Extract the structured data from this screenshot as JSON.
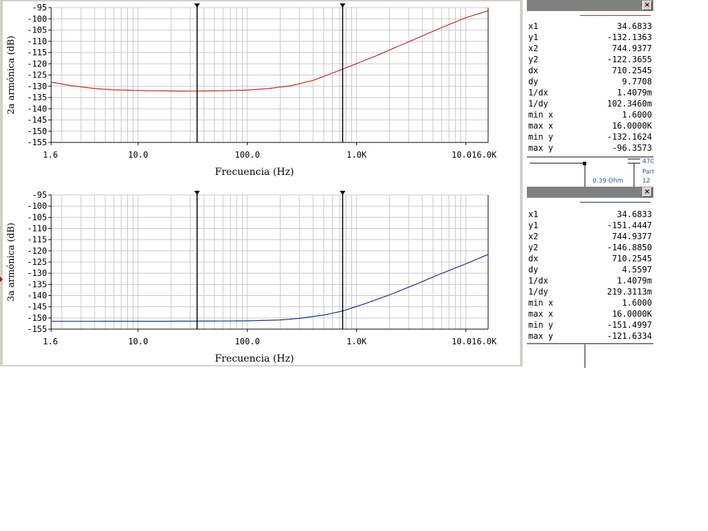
{
  "colors": {
    "trace1": "#cc2020",
    "trace2": "#1a2a90",
    "grid": "#c8c8c8",
    "cursor": "#000000",
    "window_bg": "#d4d0c8"
  },
  "chart_data": [
    {
      "type": "line",
      "x_scale": "log",
      "xlabel": "Frecuencia (Hz)",
      "ylabel": "2a armónica (dB)",
      "xlim": [
        1.6,
        16000
      ],
      "ylim": [
        -155,
        -95
      ],
      "yticks": [
        -95,
        -100,
        -105,
        -110,
        -115,
        -120,
        -125,
        -130,
        -135,
        -140,
        -145,
        -150,
        -155
      ],
      "xtick_labels": [
        "1.6",
        "10.0",
        "100.0",
        "1.0K",
        "10.016.0K"
      ],
      "grid": true,
      "cursors_x": [
        34.6833,
        744.9377
      ],
      "series": [
        {
          "x": [
            1.6,
            2.5,
            4,
            6,
            10,
            20,
            34.68,
            60,
            100,
            150,
            250,
            400,
            744.94,
            1500,
            3000,
            6000,
            10000,
            16000
          ],
          "y": [
            -128.2,
            -129.8,
            -131.0,
            -131.6,
            -131.9,
            -132.1,
            -132.14,
            -132.0,
            -131.7,
            -131.1,
            -129.8,
            -127.4,
            -122.4,
            -116.5,
            -110.2,
            -103.9,
            -99.5,
            -96.4
          ]
        }
      ]
    },
    {
      "type": "line",
      "x_scale": "log",
      "xlabel": "Frecuencia (Hz)",
      "ylabel": "3a armónica (dB)",
      "xlim": [
        1.6,
        16000
      ],
      "ylim": [
        -155,
        -95
      ],
      "yticks": [
        -95,
        -100,
        -105,
        -110,
        -115,
        -120,
        -125,
        -130,
        -135,
        -140,
        -145,
        -150,
        -155
      ],
      "xtick_labels": [
        "1.6",
        "10.0",
        "100.0",
        "1.0K",
        "10.016.0K"
      ],
      "grid": true,
      "cursors_x": [
        34.6833,
        744.9377
      ],
      "series": [
        {
          "x": [
            1.6,
            10,
            34.68,
            100,
            200,
            300,
            500,
            744.94,
            1200,
            2000,
            3500,
            6000,
            10000,
            16000
          ],
          "y": [
            -151.5,
            -151.48,
            -151.44,
            -151.3,
            -150.9,
            -150.2,
            -148.7,
            -146.9,
            -143.6,
            -139.7,
            -134.9,
            -130.1,
            -125.8,
            -121.6
          ]
        }
      ]
    }
  ],
  "panel1": {
    "close": "×",
    "rows": [
      {
        "label": "x1",
        "value": "34.6833"
      },
      {
        "label": "y1",
        "value": "-132.1363"
      },
      {
        "label": "x2",
        "value": "744.9377"
      },
      {
        "label": "y2",
        "value": "-122.3655"
      },
      {
        "label": "dx",
        "value": "710.2545"
      },
      {
        "label": "dy",
        "value": "9.7708"
      },
      {
        "label": "1/dx",
        "value": "1.4079m"
      },
      {
        "label": "1/dy",
        "value": "102.3460m"
      },
      {
        "label": "min x",
        "value": "1.6000"
      },
      {
        "label": "max x",
        "value": "16.0000K"
      },
      {
        "label": "min y",
        "value": "-132.1624"
      },
      {
        "label": "max y",
        "value": "-96.3573"
      }
    ]
  },
  "panel2": {
    "close": "×",
    "rows": [
      {
        "label": "x1",
        "value": "34.6833"
      },
      {
        "label": "y1",
        "value": "-151.4447"
      },
      {
        "label": "x2",
        "value": "744.9377"
      },
      {
        "label": "y2",
        "value": "-146.8850"
      },
      {
        "label": "dx",
        "value": "710.2545"
      },
      {
        "label": "dy",
        "value": "4.5597"
      },
      {
        "label": "1/dx",
        "value": "1.4079m"
      },
      {
        "label": "1/dy",
        "value": "219.3113m"
      },
      {
        "label": "min x",
        "value": "1.6000"
      },
      {
        "label": "max x",
        "value": "16.0000K"
      },
      {
        "label": "min y",
        "value": "-151.4997"
      },
      {
        "label": "max y",
        "value": "-121.6334"
      }
    ]
  },
  "schematic": {
    "resistor_label": "0.39  Ohm",
    "cap_label": "470",
    "part_label": "Part",
    "num_label": "12"
  }
}
